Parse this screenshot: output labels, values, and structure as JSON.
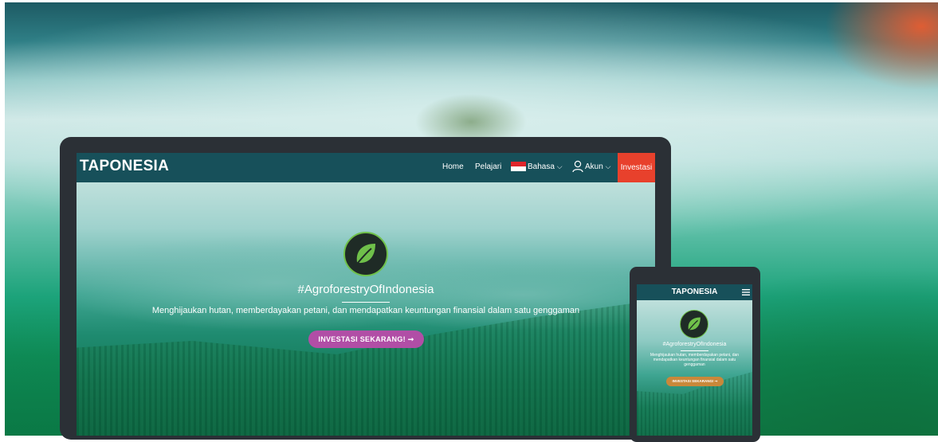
{
  "site": {
    "brand": "TAPONESIA",
    "nav": {
      "home": "Home",
      "learn": "Pelajari",
      "language": "Bahasa",
      "account": "Akun",
      "invest": "Investasi",
      "chevron": "⌵"
    },
    "hero": {
      "title": "#AgroforestryOfIndonesia",
      "subtitle": "Menghijaukan hutan, memberdayakan petani, dan mendapatkan keuntungan finansial dalam satu genggaman",
      "cta": "INVESTASI SEKARANG! ➞"
    }
  },
  "mobile": {
    "brand": "TAPONESIA",
    "hero": {
      "title": "#AgroforestryOfIndonesia",
      "subtitle": "Menghijaukan hutan, memberdayakan petani, dan mendapatkan keuntungan finansial dalam satu genggaman",
      "cta": "INVESTASI SEKARANG! ➞"
    }
  },
  "icons": {
    "logo": "leaf-icon",
    "flag": "indonesia-flag-icon",
    "account": "user-icon",
    "menu": "hamburger-menu-icon"
  },
  "colors": {
    "navbar": "#17505a",
    "invest_button": "#e8412c",
    "cta_desktop": "#b14ea6",
    "cta_mobile": "#c9883a",
    "logo_ring": "#6fc04a"
  }
}
